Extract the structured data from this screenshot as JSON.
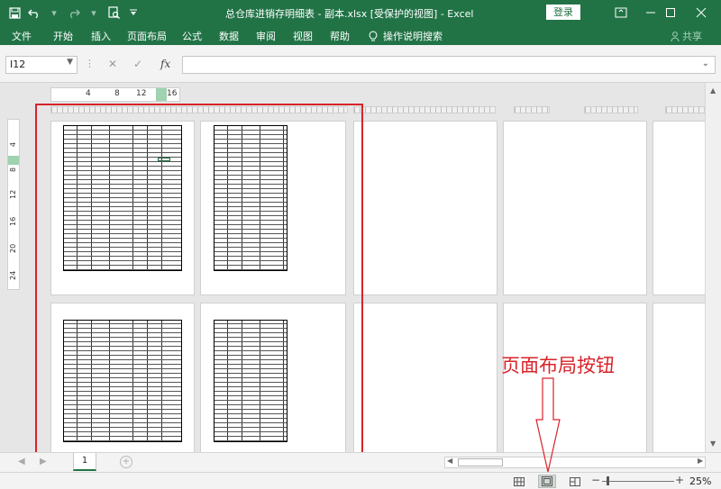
{
  "titlebar": {
    "title": "总仓库进销存明细表 - 副本.xlsx  [受保护的视图]  -  Excel",
    "login_label": "登录",
    "color": "#217346"
  },
  "qat": {
    "save_icon": "save-icon",
    "undo_icon": "undo-icon",
    "redo_icon": "redo-icon",
    "print_preview_icon": "print-preview-icon",
    "customize_icon": "chevron-down-icon"
  },
  "window_controls": [
    "ribbon-display-icon",
    "minimize-icon",
    "maximize-icon",
    "close-icon"
  ],
  "ribbon": {
    "tabs": [
      "文件",
      "开始",
      "插入",
      "页面布局",
      "公式",
      "数据",
      "审阅",
      "视图",
      "帮助"
    ],
    "tell_me": "操作说明搜索",
    "share": "共享"
  },
  "formula_bar": {
    "name_box": "I12",
    "formula_value": ""
  },
  "ruler": {
    "h_ticks": [
      "4",
      "8",
      "12",
      "16"
    ],
    "v_ticks": [
      "4",
      "8",
      "12",
      "16",
      "20",
      "24"
    ]
  },
  "sheet": {
    "tabs": [
      "1"
    ],
    "active_tab": "1"
  },
  "status": {
    "zoom_level": "25%",
    "active_view": "page-layout",
    "views": [
      "normal",
      "page-layout",
      "page-break-preview"
    ]
  },
  "annotation": {
    "text": "页面布局按钮",
    "color": "#d8232a"
  }
}
